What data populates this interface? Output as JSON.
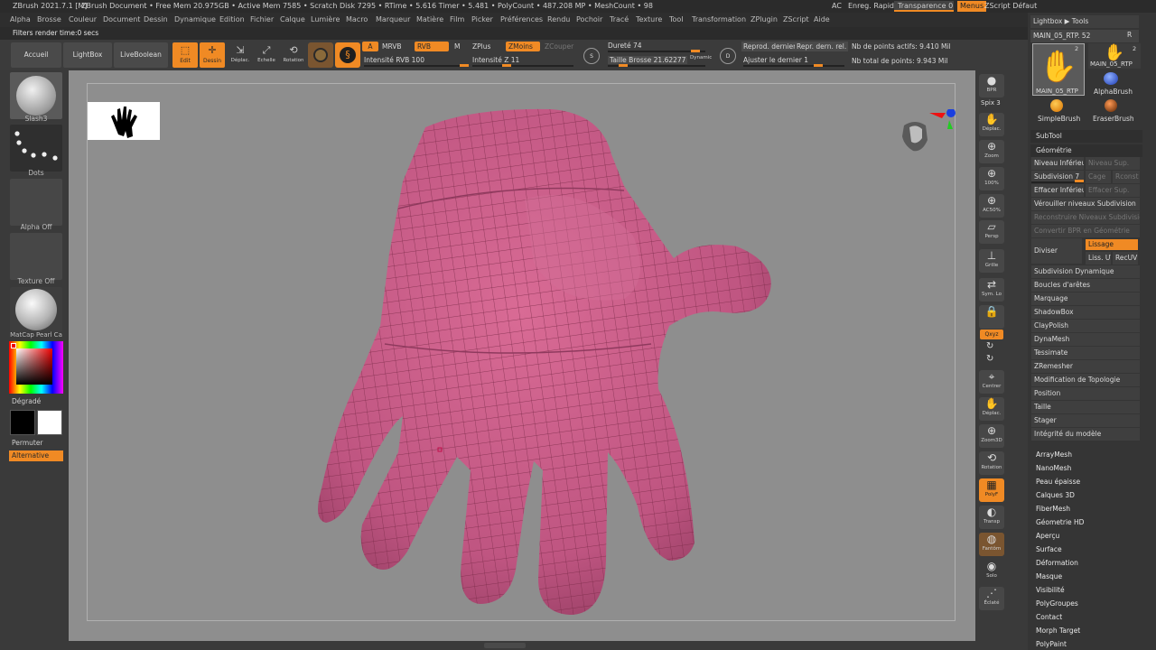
{
  "app": {
    "title": "ZBrush 2021.7.1 [M]",
    "document": "ZBrush Document",
    "stats": ". • Free Mem 20.975GB • Active Mem 7585 • Scratch Disk 7295 • RTime • 5.616 Timer • 5.481 • PolyCount • 487.208 MP • MeshCount • 98"
  },
  "titlebar_right": {
    "ac": "AC",
    "quicksave": "Enreg. Rapide",
    "transparency": "Transparence 0",
    "menus": "Menus",
    "zscript": "ZScript Défaut"
  },
  "menus": [
    "Alpha",
    "Brosse",
    "Couleur",
    "Document",
    "Dessin",
    "Dynamique",
    "Edition",
    "Fichier",
    "Calque",
    "Lumière",
    "Macro",
    "Marqueur",
    "Matière",
    "Film",
    "Picker",
    "Préférences",
    "Rendu",
    "Pochoir",
    "Tracé",
    "Texture",
    "Tool",
    "Transformation",
    "ZPlugin",
    "ZScript",
    "Aide"
  ],
  "filter": "Filters render time:0 secs",
  "toolbar": {
    "home": "Accueil",
    "lightbox": "LightBox",
    "liveboolean": "LiveBoolean",
    "edit": "Edit",
    "draw": "Dessin",
    "move": "Déplac.",
    "scale": "Echelle",
    "rotate": "Rotation",
    "a": "A",
    "mrvb": "MRVB",
    "rvb": "RVB",
    "m": "M",
    "rvb_intensity": "Intensité RVB 100",
    "zplus": "ZPlus",
    "zminus": "ZMoins",
    "zcut": "ZCouper",
    "z_intensity": "Intensité Z 11",
    "hardness": "Dureté 74",
    "brush_size": "Taille Brosse 21.62277",
    "dynamic": "Dynamic",
    "s": "S",
    "d": "D",
    "redo_last": "Reprod. dernier",
    "redo_last_rel": "Repr. dern. rel.",
    "adjust_last": "Ajuster le dernier 1",
    "active_points": "Nb de points actifs: 9.410 Mil",
    "total_points": "Nb total de points: 9.943 Mil"
  },
  "left_shelf": {
    "brush": "Slash3",
    "stroke": "Dots",
    "alpha": "Alpha Off",
    "texture": "Texture Off",
    "material": "MatCap Pearl Ca",
    "gradient": "Dégradé",
    "switch": "Permuter",
    "alternate": "Alternative"
  },
  "right_shelf": [
    {
      "icon": "bpr-icon",
      "glyph": "●",
      "label": "BPR"
    },
    {
      "icon": "move-icon",
      "glyph": "✋",
      "label": "Déplac."
    },
    {
      "icon": "zoom-icon",
      "glyph": "⊕",
      "label": "Zoom"
    },
    {
      "icon": "zoom100-icon",
      "glyph": "⊕",
      "label": "100%"
    },
    {
      "icon": "ac50-icon",
      "glyph": "⊕",
      "label": "AC50%"
    },
    {
      "icon": "persp-icon",
      "glyph": "▱",
      "label": "Persp"
    },
    {
      "icon": "floor-icon",
      "glyph": "⊥",
      "label": "Grille"
    },
    {
      "icon": "symlocal-icon",
      "glyph": "⇄",
      "label": "Sym. Lo"
    },
    {
      "icon": "lock-icon",
      "glyph": "🔒",
      "label": ""
    },
    {
      "icon": "xyz-icon",
      "glyph": "",
      "label": "Qxyz"
    },
    {
      "icon": "rotate-y-icon",
      "glyph": "↻",
      "label": ""
    },
    {
      "icon": "rotate-z-icon",
      "glyph": "↻",
      "label": ""
    },
    {
      "icon": "frame-icon",
      "glyph": "⌖",
      "label": "Centrer"
    },
    {
      "icon": "move2-icon",
      "glyph": "✋",
      "label": "Déplac."
    },
    {
      "icon": "zoom3d-icon",
      "glyph": "⊕",
      "label": "Zoom3D"
    },
    {
      "icon": "rotation-icon",
      "glyph": "⟲",
      "label": "Rotation"
    },
    {
      "icon": "polyframe-icon",
      "glyph": "▦",
      "label": "PolyF"
    },
    {
      "icon": "transp-icon",
      "glyph": "◐",
      "label": "Transp"
    },
    {
      "icon": "ghost-icon",
      "glyph": "◍",
      "label": "Fantôm"
    },
    {
      "icon": "solo-icon",
      "glyph": "◉",
      "label": "Solo"
    },
    {
      "icon": "xpose-icon",
      "glyph": "⋰",
      "label": "Éclaté"
    }
  ],
  "spix": "Spix 3",
  "right_panel": {
    "lightbox_tools": "Lightbox ▶ Tools",
    "tool_name": "MAIN_05_RTP. 52",
    "r": "R",
    "tool1": "MAIN_05_RTP",
    "tool2": "MAIN_05_RTP",
    "tool2_count": "2",
    "tool1_count": "2",
    "alphabrush": "AlphaBrush",
    "simplebrush": "SimpleBrush",
    "eraserbrush": "EraserBrush",
    "subtool": "SubTool",
    "geometry": "Géométrie",
    "lower_res": "Niveau Inférieur",
    "higher_res": "Niveau Sup.",
    "subdiv": "Subdivision 7",
    "cage": "Cage",
    "rconst": "Rconst",
    "del_lower": "Effacer Inférieur",
    "del_higher": "Effacer Sup.",
    "freeze": "Vérouiller niveaux Subdivision",
    "reconstruct": "Reconstruire Niveaux Subdivision",
    "convert_bpr": "Convertir BPR en Géométrie",
    "divide": "Diviser",
    "smooth": "Lissage",
    "smooth_uv": "Liss. UV",
    "recuv": "RecUV",
    "list": [
      "Subdivision Dynamique",
      "Boucles d'arêtes",
      "Marquage",
      "ShadowBox",
      "ClayPolish",
      "DynaMesh",
      "Tessimate",
      "ZRemesher",
      "Modification de Topologie",
      "Position",
      "Taille",
      "Stager",
      "Intégrité du modèle"
    ],
    "list2": [
      "ArrayMesh",
      "NanoMesh",
      "Peau épaisse",
      "Calques 3D",
      "FiberMesh",
      "Géometrie HD",
      "Aperçu",
      "Surface",
      "Déformation",
      "Masque",
      "Visibilité",
      "PolyGroupes",
      "Contact",
      "Morph Target",
      "PolyPaint"
    ]
  },
  "colors": {
    "accent": "#f08a24",
    "mesh": "#c4587f",
    "bg_viewport": "#8e8e8e"
  }
}
